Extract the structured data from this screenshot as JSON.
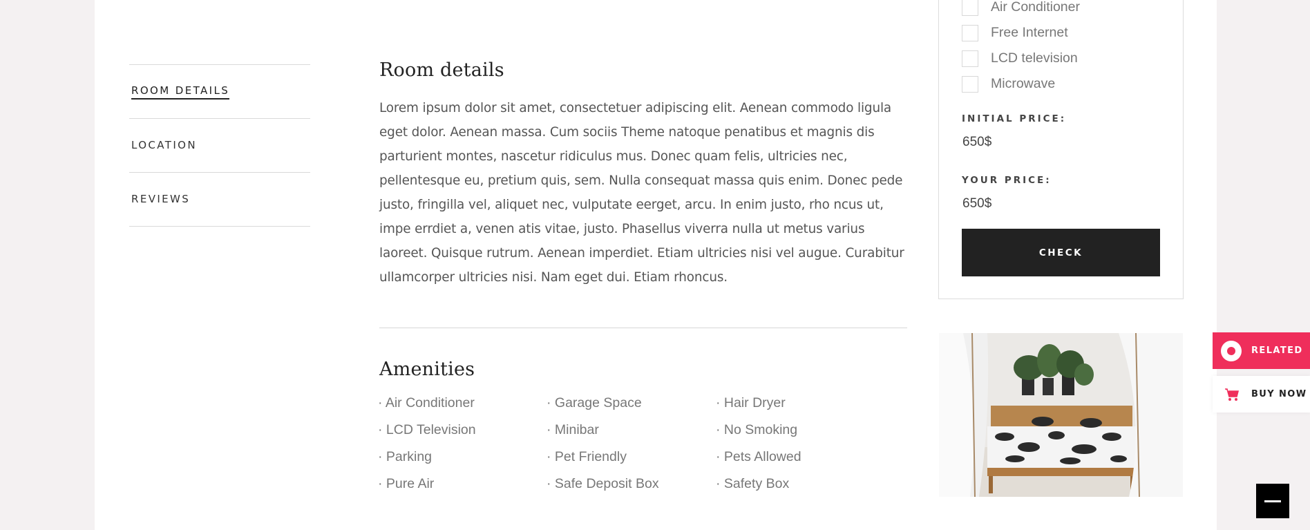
{
  "tabs": [
    {
      "label": "ROOM DETAILS",
      "active": true
    },
    {
      "label": "LOCATION",
      "active": false
    },
    {
      "label": "REVIEWS",
      "active": false
    }
  ],
  "room_details": {
    "title": "Room details",
    "description": "Lorem ipsum dolor sit amet, consectetuer adipiscing elit. Aenean commodo ligula eget dolor. Aenean massa. Cum sociis Theme natoque penatibus et magnis dis parturient montes, nascetur ridiculus mus. Donec quam felis, ultricies nec, pellentesque eu, pretium quis, sem. Nulla consequat massa quis enim. Donec pede justo, fringilla vel, aliquet nec, vulputate eerget, arcu. In enim justo, rho ncus ut, impe errdiet a, venen atis vitae, justo. Phasellus viverra nulla ut metus varius laoreet. Quisque rutrum. Aenean imperdiet. Etiam ultricies nisi vel augue. Curabitur ullamcorper ultricies nisi. Nam eget dui. Etiam rhoncus."
  },
  "amenities": {
    "title": "Amenities",
    "items": [
      "· Air Conditioner",
      "· Garage Space",
      "· Hair Dryer",
      "· LCD Television",
      "· Minibar",
      "· No Smoking",
      "· Parking",
      "· Pet Friendly",
      "· Pets Allowed",
      "· Pure Air",
      "· Safe Deposit Box",
      "· Safety Box"
    ]
  },
  "booking": {
    "options": [
      "Air Conditioner",
      "Free Internet",
      "LCD television",
      "Microwave"
    ],
    "initial_price_label": "INITIAL PRICE:",
    "initial_price": "650$",
    "your_price_label": "YOUR PRICE:",
    "your_price": "650$",
    "check_label": "CHECK"
  },
  "side": {
    "related_label": "RELATED",
    "buy_label": "BUY NOW"
  },
  "colors": {
    "accent": "#ef2e5b",
    "dark": "#222222",
    "page_bg": "#f4f1f2"
  }
}
